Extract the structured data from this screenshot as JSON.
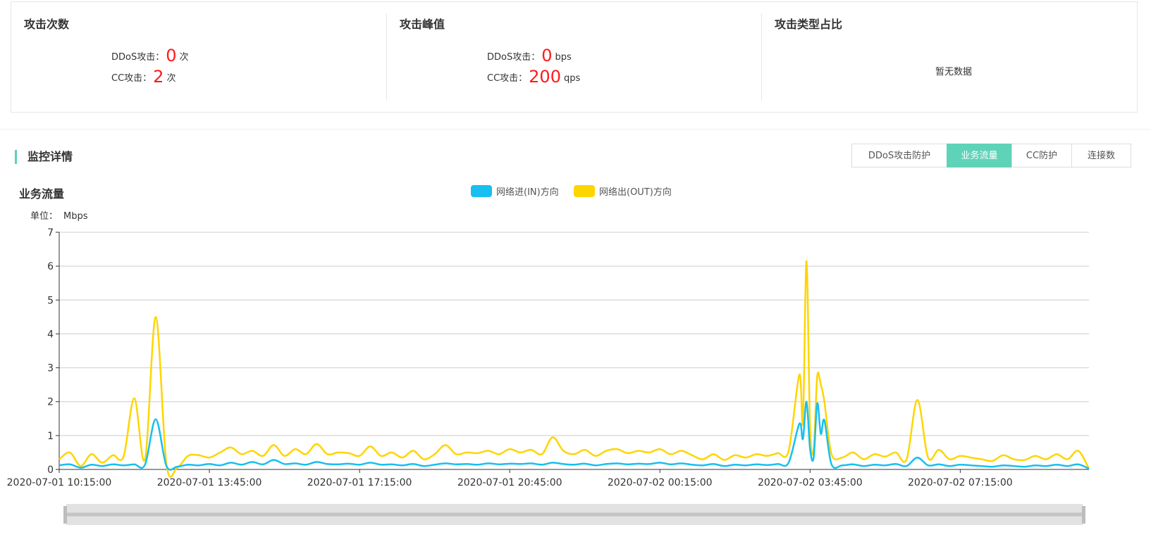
{
  "summary": {
    "attack_count": {
      "title": "攻击次数",
      "ddos_label": "DDoS攻击：",
      "ddos_value": "0",
      "ddos_unit": "次",
      "cc_label": "CC攻击：",
      "cc_value": "2",
      "cc_unit": "次"
    },
    "attack_peak": {
      "title": "攻击峰值",
      "ddos_label": "DDoS攻击：",
      "ddos_value": "0",
      "ddos_unit": "bps",
      "cc_label": "CC攻击：",
      "cc_value": "200",
      "cc_unit": "qps"
    },
    "attack_type_ratio": {
      "title": "攻击类型占比",
      "empty_text": "暂无数据"
    }
  },
  "monitor": {
    "title": "监控详情",
    "tabs": [
      {
        "label": "DDoS攻击防护",
        "active": false
      },
      {
        "label": "业务流量",
        "active": true
      },
      {
        "label": "CC防护",
        "active": false
      },
      {
        "label": "连接数",
        "active": false
      }
    ]
  },
  "chart_header": {
    "title": "业务流量",
    "unit_label": "单位：",
    "unit_value": "Mbps"
  },
  "colors": {
    "in": "#18bff0",
    "out": "#ffd500",
    "accent": "#5fd3b8",
    "alert": "#ff1a1a"
  },
  "chart_data": {
    "type": "line",
    "ylim": [
      0,
      7
    ],
    "yticks": [
      0,
      1,
      2,
      3,
      4,
      5,
      6,
      7
    ],
    "x_tick_labels": [
      "2020-07-01 10:15:00",
      "2020-07-01 13:45:00",
      "2020-07-01 17:15:00",
      "2020-07-01 20:45:00",
      "2020-07-02 00:15:00",
      "2020-07-02 03:45:00",
      "2020-07-02 07:15:00"
    ],
    "x_start": "2020-07-01 10:15:00",
    "x_end": "2020-07-02 10:15:00",
    "grid": true,
    "legend_position": "top-center",
    "series": [
      {
        "name": "网络进(IN)方向",
        "color": "#18bff0",
        "points": [
          [
            "2020-07-01 10:15:00",
            0.12
          ],
          [
            "2020-07-01 10:30:00",
            0.15
          ],
          [
            "2020-07-01 10:45:00",
            0.05
          ],
          [
            "2020-07-01 11:00:00",
            0.14
          ],
          [
            "2020-07-01 11:15:00",
            0.1
          ],
          [
            "2020-07-01 11:30:00",
            0.15
          ],
          [
            "2020-07-01 11:45:00",
            0.12
          ],
          [
            "2020-07-01 12:00:00",
            0.15
          ],
          [
            "2020-07-01 12:15:00",
            0.14
          ],
          [
            "2020-07-01 12:30:00",
            1.48
          ],
          [
            "2020-07-01 12:45:00",
            0.1
          ],
          [
            "2020-07-01 13:00:00",
            0.08
          ],
          [
            "2020-07-01 13:15:00",
            0.14
          ],
          [
            "2020-07-01 13:30:00",
            0.12
          ],
          [
            "2020-07-01 13:45:00",
            0.16
          ],
          [
            "2020-07-01 14:00:00",
            0.12
          ],
          [
            "2020-07-01 14:15:00",
            0.2
          ],
          [
            "2020-07-01 14:30:00",
            0.14
          ],
          [
            "2020-07-01 14:45:00",
            0.22
          ],
          [
            "2020-07-01 15:00:00",
            0.15
          ],
          [
            "2020-07-01 15:15:00",
            0.28
          ],
          [
            "2020-07-01 15:30:00",
            0.16
          ],
          [
            "2020-07-01 15:45:00",
            0.18
          ],
          [
            "2020-07-01 16:00:00",
            0.14
          ],
          [
            "2020-07-01 16:15:00",
            0.22
          ],
          [
            "2020-07-01 16:30:00",
            0.16
          ],
          [
            "2020-07-01 16:45:00",
            0.15
          ],
          [
            "2020-07-01 17:00:00",
            0.17
          ],
          [
            "2020-07-01 17:15:00",
            0.14
          ],
          [
            "2020-07-01 17:30:00",
            0.2
          ],
          [
            "2020-07-01 17:45:00",
            0.14
          ],
          [
            "2020-07-01 18:00:00",
            0.15
          ],
          [
            "2020-07-01 18:15:00",
            0.12
          ],
          [
            "2020-07-01 18:30:00",
            0.16
          ],
          [
            "2020-07-01 18:45:00",
            0.1
          ],
          [
            "2020-07-01 19:00:00",
            0.14
          ],
          [
            "2020-07-01 19:15:00",
            0.18
          ],
          [
            "2020-07-01 19:30:00",
            0.15
          ],
          [
            "2020-07-01 19:45:00",
            0.16
          ],
          [
            "2020-07-01 20:00:00",
            0.14
          ],
          [
            "2020-07-01 20:15:00",
            0.18
          ],
          [
            "2020-07-01 20:30:00",
            0.15
          ],
          [
            "2020-07-01 20:45:00",
            0.17
          ],
          [
            "2020-07-01 21:00:00",
            0.16
          ],
          [
            "2020-07-01 21:15:00",
            0.18
          ],
          [
            "2020-07-01 21:30:00",
            0.14
          ],
          [
            "2020-07-01 21:45:00",
            0.2
          ],
          [
            "2020-07-01 22:00:00",
            0.16
          ],
          [
            "2020-07-01 22:15:00",
            0.14
          ],
          [
            "2020-07-01 22:30:00",
            0.17
          ],
          [
            "2020-07-01 22:45:00",
            0.12
          ],
          [
            "2020-07-01 23:00:00",
            0.16
          ],
          [
            "2020-07-01 23:15:00",
            0.18
          ],
          [
            "2020-07-01 23:30:00",
            0.15
          ],
          [
            "2020-07-01 23:45:00",
            0.17
          ],
          [
            "2020-07-02 00:00:00",
            0.16
          ],
          [
            "2020-07-02 00:15:00",
            0.2
          ],
          [
            "2020-07-02 00:30:00",
            0.15
          ],
          [
            "2020-07-02 00:45:00",
            0.18
          ],
          [
            "2020-07-02 01:00:00",
            0.14
          ],
          [
            "2020-07-02 01:15:00",
            0.12
          ],
          [
            "2020-07-02 01:30:00",
            0.16
          ],
          [
            "2020-07-02 01:45:00",
            0.1
          ],
          [
            "2020-07-02 02:00:00",
            0.14
          ],
          [
            "2020-07-02 02:15:00",
            0.12
          ],
          [
            "2020-07-02 02:30:00",
            0.15
          ],
          [
            "2020-07-02 02:45:00",
            0.13
          ],
          [
            "2020-07-02 03:00:00",
            0.16
          ],
          [
            "2020-07-02 03:15:00",
            0.2
          ],
          [
            "2020-07-02 03:30:00",
            1.35
          ],
          [
            "2020-07-02 03:35:00",
            0.9
          ],
          [
            "2020-07-02 03:40:00",
            2.0
          ],
          [
            "2020-07-02 03:45:00",
            0.6
          ],
          [
            "2020-07-02 03:50:00",
            0.35
          ],
          [
            "2020-07-02 03:55:00",
            1.95
          ],
          [
            "2020-07-02 04:00:00",
            1.05
          ],
          [
            "2020-07-02 04:05:00",
            1.45
          ],
          [
            "2020-07-02 04:15:00",
            0.15
          ],
          [
            "2020-07-02 04:30:00",
            0.12
          ],
          [
            "2020-07-02 04:45:00",
            0.15
          ],
          [
            "2020-07-02 05:00:00",
            0.1
          ],
          [
            "2020-07-02 05:15:00",
            0.14
          ],
          [
            "2020-07-02 05:30:00",
            0.12
          ],
          [
            "2020-07-02 05:45:00",
            0.16
          ],
          [
            "2020-07-02 06:00:00",
            0.1
          ],
          [
            "2020-07-02 06:15:00",
            0.35
          ],
          [
            "2020-07-02 06:30:00",
            0.12
          ],
          [
            "2020-07-02 06:45:00",
            0.15
          ],
          [
            "2020-07-02 07:00:00",
            0.1
          ],
          [
            "2020-07-02 07:15:00",
            0.14
          ],
          [
            "2020-07-02 07:30:00",
            0.12
          ],
          [
            "2020-07-02 07:45:00",
            0.1
          ],
          [
            "2020-07-02 08:00:00",
            0.08
          ],
          [
            "2020-07-02 08:15:00",
            0.12
          ],
          [
            "2020-07-02 08:30:00",
            0.1
          ],
          [
            "2020-07-02 08:45:00",
            0.08
          ],
          [
            "2020-07-02 09:00:00",
            0.12
          ],
          [
            "2020-07-02 09:15:00",
            0.1
          ],
          [
            "2020-07-02 09:30:00",
            0.14
          ],
          [
            "2020-07-02 09:45:00",
            0.1
          ],
          [
            "2020-07-02 10:00:00",
            0.15
          ],
          [
            "2020-07-02 10:15:00",
            0.02
          ]
        ]
      },
      {
        "name": "网络出(OUT)方向",
        "color": "#ffd500",
        "points": [
          [
            "2020-07-01 10:15:00",
            0.3
          ],
          [
            "2020-07-01 10:30:00",
            0.5
          ],
          [
            "2020-07-01 10:45:00",
            0.1
          ],
          [
            "2020-07-01 11:00:00",
            0.45
          ],
          [
            "2020-07-01 11:15:00",
            0.2
          ],
          [
            "2020-07-01 11:30:00",
            0.42
          ],
          [
            "2020-07-01 11:45:00",
            0.38
          ],
          [
            "2020-07-01 12:00:00",
            2.1
          ],
          [
            "2020-07-01 12:15:00",
            0.3
          ],
          [
            "2020-07-01 12:30:00",
            4.5
          ],
          [
            "2020-07-01 12:45:00",
            0.15
          ],
          [
            "2020-07-01 13:00:00",
            0.05
          ],
          [
            "2020-07-01 13:15:00",
            0.4
          ],
          [
            "2020-07-01 13:30:00",
            0.42
          ],
          [
            "2020-07-01 13:45:00",
            0.35
          ],
          [
            "2020-07-01 14:00:00",
            0.5
          ],
          [
            "2020-07-01 14:15:00",
            0.65
          ],
          [
            "2020-07-01 14:30:00",
            0.45
          ],
          [
            "2020-07-01 14:45:00",
            0.55
          ],
          [
            "2020-07-01 15:00:00",
            0.4
          ],
          [
            "2020-07-01 15:15:00",
            0.72
          ],
          [
            "2020-07-01 15:30:00",
            0.4
          ],
          [
            "2020-07-01 15:45:00",
            0.6
          ],
          [
            "2020-07-01 16:00:00",
            0.45
          ],
          [
            "2020-07-01 16:15:00",
            0.75
          ],
          [
            "2020-07-01 16:30:00",
            0.45
          ],
          [
            "2020-07-01 16:45:00",
            0.5
          ],
          [
            "2020-07-01 17:00:00",
            0.48
          ],
          [
            "2020-07-01 17:15:00",
            0.4
          ],
          [
            "2020-07-01 17:30:00",
            0.68
          ],
          [
            "2020-07-01 17:45:00",
            0.4
          ],
          [
            "2020-07-01 18:00:00",
            0.5
          ],
          [
            "2020-07-01 18:15:00",
            0.35
          ],
          [
            "2020-07-01 18:30:00",
            0.55
          ],
          [
            "2020-07-01 18:45:00",
            0.3
          ],
          [
            "2020-07-01 19:00:00",
            0.45
          ],
          [
            "2020-07-01 19:15:00",
            0.72
          ],
          [
            "2020-07-01 19:30:00",
            0.45
          ],
          [
            "2020-07-01 19:45:00",
            0.5
          ],
          [
            "2020-07-01 20:00:00",
            0.48
          ],
          [
            "2020-07-01 20:15:00",
            0.55
          ],
          [
            "2020-07-01 20:30:00",
            0.45
          ],
          [
            "2020-07-01 20:45:00",
            0.6
          ],
          [
            "2020-07-01 21:00:00",
            0.5
          ],
          [
            "2020-07-01 21:15:00",
            0.58
          ],
          [
            "2020-07-01 21:30:00",
            0.45
          ],
          [
            "2020-07-01 21:45:00",
            0.95
          ],
          [
            "2020-07-01 22:00:00",
            0.55
          ],
          [
            "2020-07-01 22:15:00",
            0.45
          ],
          [
            "2020-07-01 22:30:00",
            0.58
          ],
          [
            "2020-07-01 22:45:00",
            0.4
          ],
          [
            "2020-07-01 23:00:00",
            0.55
          ],
          [
            "2020-07-01 23:15:00",
            0.6
          ],
          [
            "2020-07-01 23:30:00",
            0.48
          ],
          [
            "2020-07-01 23:45:00",
            0.55
          ],
          [
            "2020-07-02 00:00:00",
            0.5
          ],
          [
            "2020-07-02 00:15:00",
            0.6
          ],
          [
            "2020-07-02 00:30:00",
            0.45
          ],
          [
            "2020-07-02 00:45:00",
            0.55
          ],
          [
            "2020-07-02 01:00:00",
            0.42
          ],
          [
            "2020-07-02 01:15:00",
            0.3
          ],
          [
            "2020-07-02 01:30:00",
            0.45
          ],
          [
            "2020-07-02 01:45:00",
            0.28
          ],
          [
            "2020-07-02 02:00:00",
            0.42
          ],
          [
            "2020-07-02 02:15:00",
            0.35
          ],
          [
            "2020-07-02 02:30:00",
            0.45
          ],
          [
            "2020-07-02 02:45:00",
            0.4
          ],
          [
            "2020-07-02 03:00:00",
            0.48
          ],
          [
            "2020-07-02 03:15:00",
            0.55
          ],
          [
            "2020-07-02 03:30:00",
            2.8
          ],
          [
            "2020-07-02 03:35:00",
            1.4
          ],
          [
            "2020-07-02 03:40:00",
            6.15
          ],
          [
            "2020-07-02 03:45:00",
            1.2
          ],
          [
            "2020-07-02 03:50:00",
            0.6
          ],
          [
            "2020-07-02 03:55:00",
            2.75
          ],
          [
            "2020-07-02 04:00:00",
            2.5
          ],
          [
            "2020-07-02 04:05:00",
            2.0
          ],
          [
            "2020-07-02 04:15:00",
            0.45
          ],
          [
            "2020-07-02 04:30:00",
            0.35
          ],
          [
            "2020-07-02 04:45:00",
            0.5
          ],
          [
            "2020-07-02 05:00:00",
            0.3
          ],
          [
            "2020-07-02 05:15:00",
            0.45
          ],
          [
            "2020-07-02 05:30:00",
            0.38
          ],
          [
            "2020-07-02 05:45:00",
            0.5
          ],
          [
            "2020-07-02 06:00:00",
            0.3
          ],
          [
            "2020-07-02 06:15:00",
            2.05
          ],
          [
            "2020-07-02 06:30:00",
            0.35
          ],
          [
            "2020-07-02 06:45:00",
            0.58
          ],
          [
            "2020-07-02 07:00:00",
            0.3
          ],
          [
            "2020-07-02 07:15:00",
            0.4
          ],
          [
            "2020-07-02 07:30:00",
            0.35
          ],
          [
            "2020-07-02 07:45:00",
            0.3
          ],
          [
            "2020-07-02 08:00:00",
            0.25
          ],
          [
            "2020-07-02 08:15:00",
            0.42
          ],
          [
            "2020-07-02 08:30:00",
            0.3
          ],
          [
            "2020-07-02 08:45:00",
            0.28
          ],
          [
            "2020-07-02 09:00:00",
            0.4
          ],
          [
            "2020-07-02 09:15:00",
            0.3
          ],
          [
            "2020-07-02 09:30:00",
            0.45
          ],
          [
            "2020-07-02 09:45:00",
            0.3
          ],
          [
            "2020-07-02 10:00:00",
            0.55
          ],
          [
            "2020-07-02 10:15:00",
            0.02
          ]
        ]
      }
    ]
  }
}
